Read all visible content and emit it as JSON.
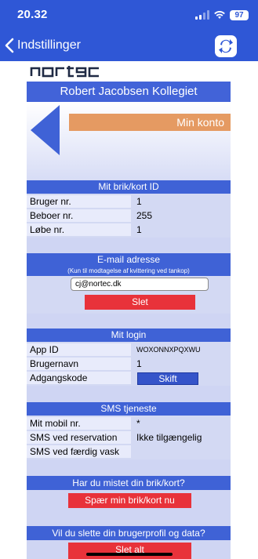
{
  "status": {
    "time": "20.32",
    "battery": "97"
  },
  "nav": {
    "back_label": "Indstillinger"
  },
  "brand": {
    "logo_text": "nortec",
    "title": "Robert Jacobsen Kollegiet"
  },
  "account": {
    "label": "Min konto"
  },
  "card_id": {
    "heading": "Mit brik/kort ID",
    "rows": [
      {
        "label": "Bruger nr.",
        "value": "1"
      },
      {
        "label": "Beboer nr.",
        "value": "255"
      },
      {
        "label": "Løbe nr.",
        "value": "1"
      }
    ]
  },
  "email": {
    "heading": "E-mail adresse",
    "subheading": "(Kun til modtagelse af kvittering ved tankop)",
    "value": "cj@nortec.dk",
    "delete_label": "Slet"
  },
  "login": {
    "heading": "Mit login",
    "rows": [
      {
        "label": "App ID",
        "value": "WOXONNXPQXWU"
      },
      {
        "label": "Brugernavn",
        "value": "1"
      },
      {
        "label": "Adgangskode",
        "value": ""
      }
    ],
    "change_label": "Skift"
  },
  "sms": {
    "heading": "SMS tjeneste",
    "rows": [
      {
        "label": "Mit mobil nr.",
        "value": "*"
      },
      {
        "label": "SMS ved reservation",
        "value": "Ikke tilgængelig"
      },
      {
        "label": "SMS ved færdig vask",
        "value": ""
      }
    ]
  },
  "lost_card": {
    "heading": "Har du mistet din brik/kort?",
    "button_label": "Spær min brik/kort nu"
  },
  "delete_profile": {
    "heading": "Vil du slette din brugerprofil og data?",
    "button_label": "Slet alt"
  },
  "colors": {
    "accent": "#2f57d6",
    "danger": "#e8323a",
    "account": "#e59a62"
  }
}
